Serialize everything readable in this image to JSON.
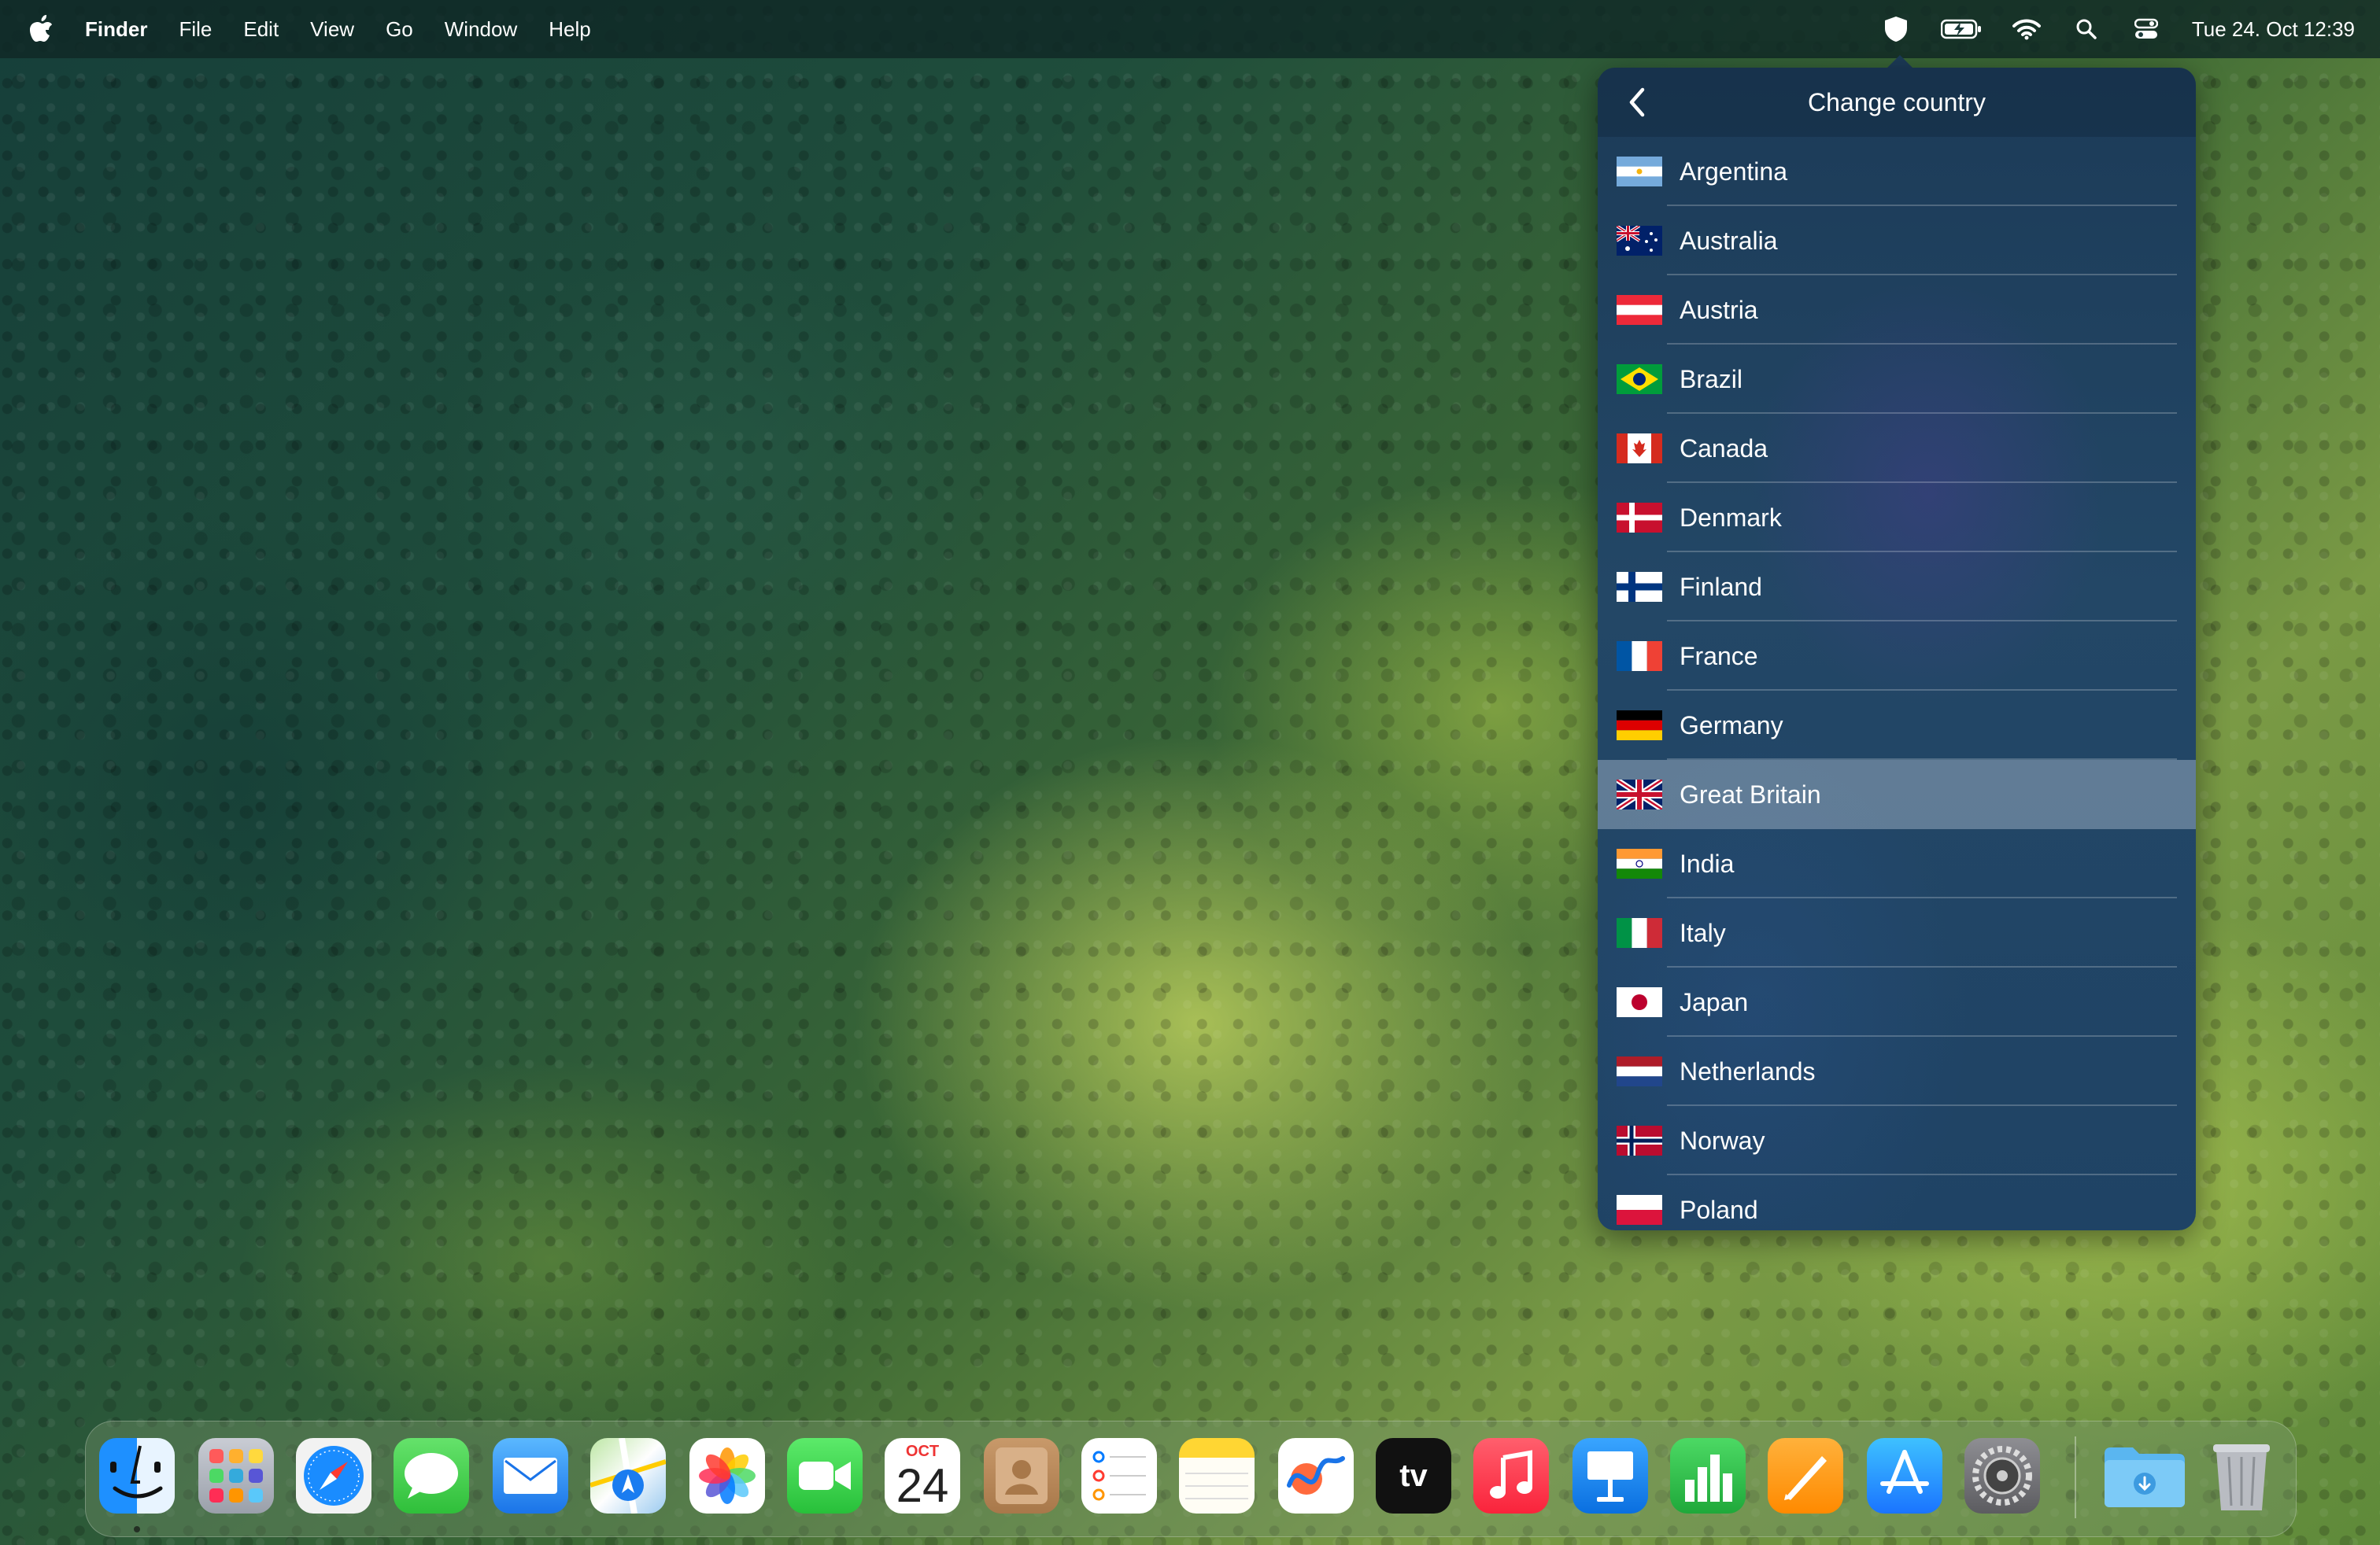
{
  "menubar": {
    "app_name": "Finder",
    "menus": [
      "File",
      "Edit",
      "View",
      "Go",
      "Window",
      "Help"
    ],
    "clock": "Tue 24. Oct  12:39",
    "status_icons": [
      "vpn-shield-icon",
      "battery-charging-icon",
      "wifi-icon",
      "spotlight-search-icon",
      "control-center-icon"
    ]
  },
  "popover": {
    "title": "Change country",
    "selected": "Great Britain",
    "countries": [
      "Argentina",
      "Australia",
      "Austria",
      "Brazil",
      "Canada",
      "Denmark",
      "Finland",
      "France",
      "Germany",
      "Great Britain",
      "India",
      "Italy",
      "Japan",
      "Netherlands",
      "Norway",
      "Poland"
    ]
  },
  "dock": {
    "apps": [
      "Finder",
      "Launchpad",
      "Safari",
      "Messages",
      "Mail",
      "Maps",
      "Photos",
      "FaceTime",
      "Calendar",
      "Contacts",
      "Reminders",
      "Notes",
      "Freeform",
      "TV",
      "Music",
      "Keynote",
      "Numbers",
      "Pages",
      "App Store",
      "System Settings",
      "Downloads",
      "Trash"
    ],
    "calendar_month": "OCT",
    "calendar_day": "24",
    "tv_label": "tv"
  }
}
